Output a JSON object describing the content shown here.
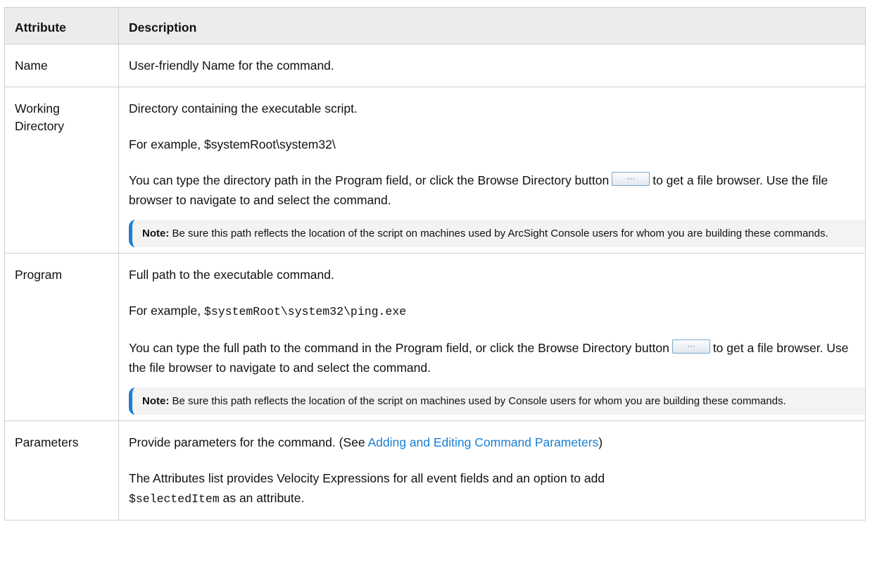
{
  "table": {
    "headers": {
      "attribute": "Attribute",
      "description": "Description"
    },
    "rows": [
      {
        "attribute": "Name",
        "desc_1": "User-friendly Name for the command."
      },
      {
        "attribute": "Working Directory",
        "desc_1": "Directory containing the executable script.",
        "desc_2": "For example, $systemRoot\\system32\\",
        "desc_3": "You can type the directory path in the Program field, or click the Browse",
        "desc_4_before": "Directory button",
        "desc_4_after": "to get a file browser. Use the file browser to navigate to and select the command.",
        "note_label": "Note:",
        "note_text": "Be sure this path reflects the location of the script on machines used by ArcSight Console users for whom you are building these commands."
      },
      {
        "attribute": "Program",
        "desc_1": "Full path to the executable command.",
        "desc_2_prefix": "For example, ",
        "desc_2_code": "$systemRoot\\system32\\ping.exe",
        "desc_3_before": "You can type the full path to the command in the Program field, or click the Browse Directory button",
        "desc_3_after": "to get a file browser. Use the file browser to navigate to and select the command.",
        "note_label": "Note:",
        "note_text": "Be sure this path reflects the location of the script on machines used by Console users for whom you are building these commands."
      },
      {
        "attribute": "Parameters",
        "desc_1_before": "Provide parameters for the command. (See ",
        "desc_1_link": "Adding and Editing Command Parameters",
        "desc_1_after": ")",
        "desc_2_before": "The Attributes list provides Velocity Expressions for all event fields and an option to add",
        "desc_2_code": "$selectedItem",
        "desc_2_after": " as an attribute."
      }
    ]
  },
  "browse_button": {
    "glyph": "···",
    "icon": "ellipsis-icon"
  },
  "colors": {
    "header_bg": "#ececec",
    "accent": "#1a7fd4",
    "note_bg": "#f3f3f3",
    "border": "#d0d0d0"
  }
}
